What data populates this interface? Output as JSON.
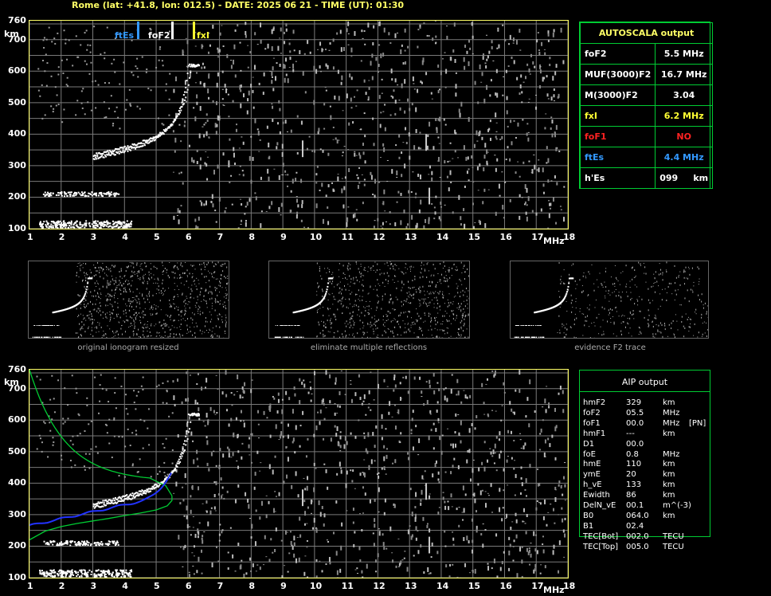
{
  "header": {
    "title": "Rome (lat: +41.8, lon: 012.5) - DATE: 2025 06 21 - TIME (UT): 01:30"
  },
  "axes": {
    "y_unit": "km",
    "x_unit": "MHz",
    "y_ticks": [
      "760",
      "700",
      "600",
      "500",
      "400",
      "300",
      "200",
      "100"
    ],
    "x_ticks": [
      "1",
      "2",
      "3",
      "4",
      "5",
      "6",
      "7",
      "8",
      "9",
      "10",
      "11",
      "12",
      "13",
      "14",
      "15",
      "16",
      "17",
      "18"
    ]
  },
  "markers": {
    "ftEs": "ftEs",
    "foF2": "foF2",
    "fxI": "fxI"
  },
  "autoscala": {
    "title": "AUTOSCALA output",
    "rows": [
      {
        "label": "foF2",
        "value": "5.5 MHz",
        "color": "#ffffff"
      },
      {
        "label": "MUF(3000)F2",
        "value": "16.7 MHz",
        "color": "#ffffff"
      },
      {
        "label": "M(3000)F2",
        "value": "3.04",
        "color": "#ffffff"
      },
      {
        "label": "fxI",
        "value": "6.2 MHz",
        "color": "#ffff33"
      },
      {
        "label": "foF1",
        "value": "NO",
        "color": "#ff2222"
      },
      {
        "label": "ftEs",
        "value": "4.4 MHz",
        "color": "#3399ff"
      },
      {
        "label": "h'Es",
        "value": "099     km",
        "color": "#ffffff"
      }
    ]
  },
  "thumbnails": [
    {
      "caption": "original ionogram resized"
    },
    {
      "caption": "eliminate multiple reflections"
    },
    {
      "caption": "evidence F2 trace"
    }
  ],
  "aip": {
    "title": "AIP output",
    "rows": [
      {
        "label": "hmF2",
        "value": "329",
        "unit": "km",
        "note": ""
      },
      {
        "label": "foF2",
        "value": "05.5",
        "unit": "MHz",
        "note": ""
      },
      {
        "label": "foF1",
        "value": "00.0",
        "unit": "MHz",
        "note": "[PN]"
      },
      {
        "label": "hmF1",
        "value": "---",
        "unit": "km",
        "note": ""
      },
      {
        "label": "D1",
        "value": "00.0",
        "unit": "",
        "note": ""
      },
      {
        "label": "foE",
        "value": "0.8",
        "unit": "MHz",
        "note": ""
      },
      {
        "label": "hmE",
        "value": "110",
        "unit": "km",
        "note": ""
      },
      {
        "label": "ymE",
        "value": "20",
        "unit": "km",
        "note": ""
      },
      {
        "label": "h_vE",
        "value": "133",
        "unit": "km",
        "note": ""
      },
      {
        "label": "Ewidth",
        "value": "86",
        "unit": "km",
        "note": ""
      },
      {
        "label": "DelN_vE",
        "value": "00.1",
        "unit": "m^(-3)",
        "note": ""
      },
      {
        "label": "B0",
        "value": "064.0",
        "unit": "km",
        "note": ""
      },
      {
        "label": "B1",
        "value": "02.4",
        "unit": "",
        "note": ""
      },
      {
        "label": "TEC[Bot]",
        "value": "002.0",
        "unit": "TECU",
        "note": ""
      },
      {
        "label": "TEC[Top]",
        "value": "005.0",
        "unit": "TECU",
        "note": ""
      }
    ]
  },
  "colors": {
    "frame": "#ffff66",
    "grid": "#7a7a7a",
    "box": "#00cc33",
    "ftEs": "#3399ff",
    "fxI": "#ffff33",
    "profile": "#00cc33",
    "fit": "#2233ff"
  }
}
